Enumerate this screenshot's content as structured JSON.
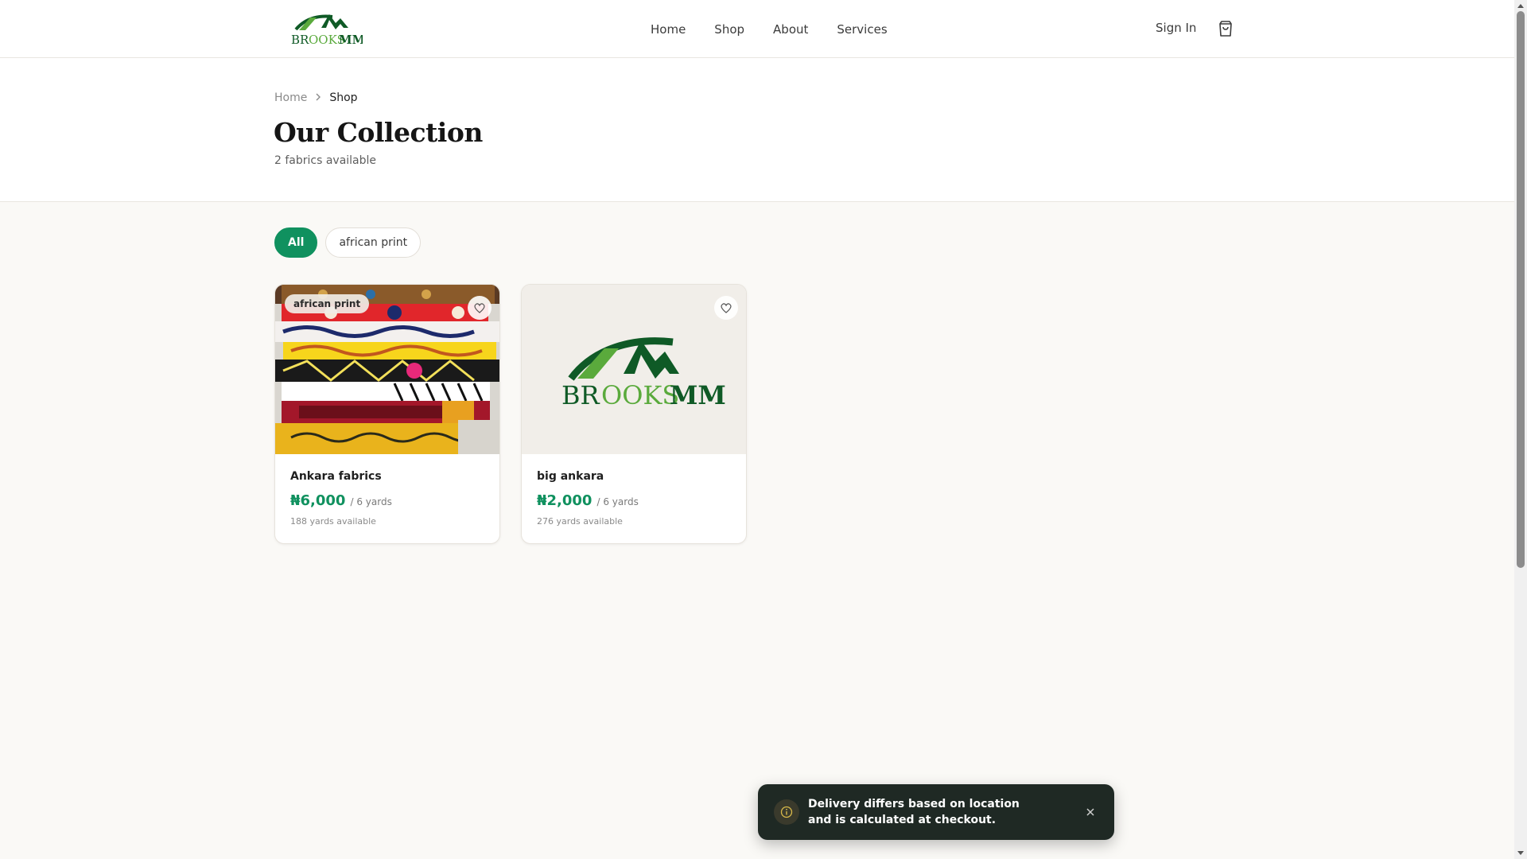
{
  "brand": {
    "logo_text": "BROOKSMM",
    "logo_text_a": "BR",
    "logo_text_b": "OOKS",
    "logo_text_c": "MM"
  },
  "nav": {
    "items": [
      {
        "label": "Home"
      },
      {
        "label": "Shop"
      },
      {
        "label": "About"
      },
      {
        "label": "Services"
      }
    ],
    "sign_in": "Sign In",
    "cart_icon": "shopping-bag-icon"
  },
  "breadcrumb": {
    "home": "Home",
    "current": "Shop"
  },
  "page": {
    "title": "Our Collection",
    "subtitle": "2 fabrics available"
  },
  "filters": [
    {
      "label": "All",
      "active": true
    },
    {
      "label": "african print",
      "active": false
    }
  ],
  "products": [
    {
      "name": "Ankara fabrics",
      "price": "₦6,000",
      "unit": "/ 6 yards",
      "stock": "188 yards available",
      "tag": "african print"
    },
    {
      "name": "big ankara",
      "price": "₦2,000",
      "unit": "/ 6 yards",
      "stock": "276 yards available"
    }
  ],
  "toast": {
    "message": "Delivery differs based on location and is calculated at checkout.",
    "icon": "info-icon"
  },
  "colors": {
    "accent": "#10915f",
    "logo_dark_green": "#0f5a26",
    "logo_light_green": "#5aaa3c",
    "toast_bg": "#1f2924"
  }
}
